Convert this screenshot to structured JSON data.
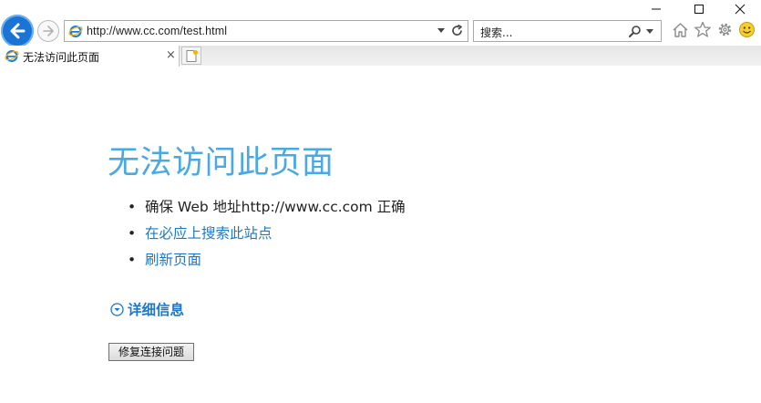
{
  "browser": {
    "address": "http://www.cc.com/test.html",
    "search_placeholder": "搜索...",
    "tab_title": "无法访问此页面",
    "tab_close": "×"
  },
  "page": {
    "title": "无法访问此页面",
    "bullets": [
      {
        "text": "确保 Web 地址http://www.cc.com 正确",
        "link": false
      },
      {
        "text": "在必应上搜索此站点",
        "link": true
      },
      {
        "text": "刷新页面",
        "link": true
      }
    ],
    "details_label": "详细信息",
    "fix_button": "修复连接问题"
  },
  "colors": {
    "title": "#4aa8e2",
    "link": "#1e78c8",
    "back_button": "#1a74d6"
  },
  "icons": [
    "minimize-icon",
    "maximize-icon",
    "close-icon",
    "back-arrow-icon",
    "forward-arrow-icon",
    "ie-logo-icon",
    "dropdown-icon",
    "refresh-icon",
    "search-icon",
    "home-icon",
    "favorites-star-icon",
    "gear-icon",
    "smiley-icon",
    "new-tab-icon",
    "chevron-down-circle-icon"
  ]
}
